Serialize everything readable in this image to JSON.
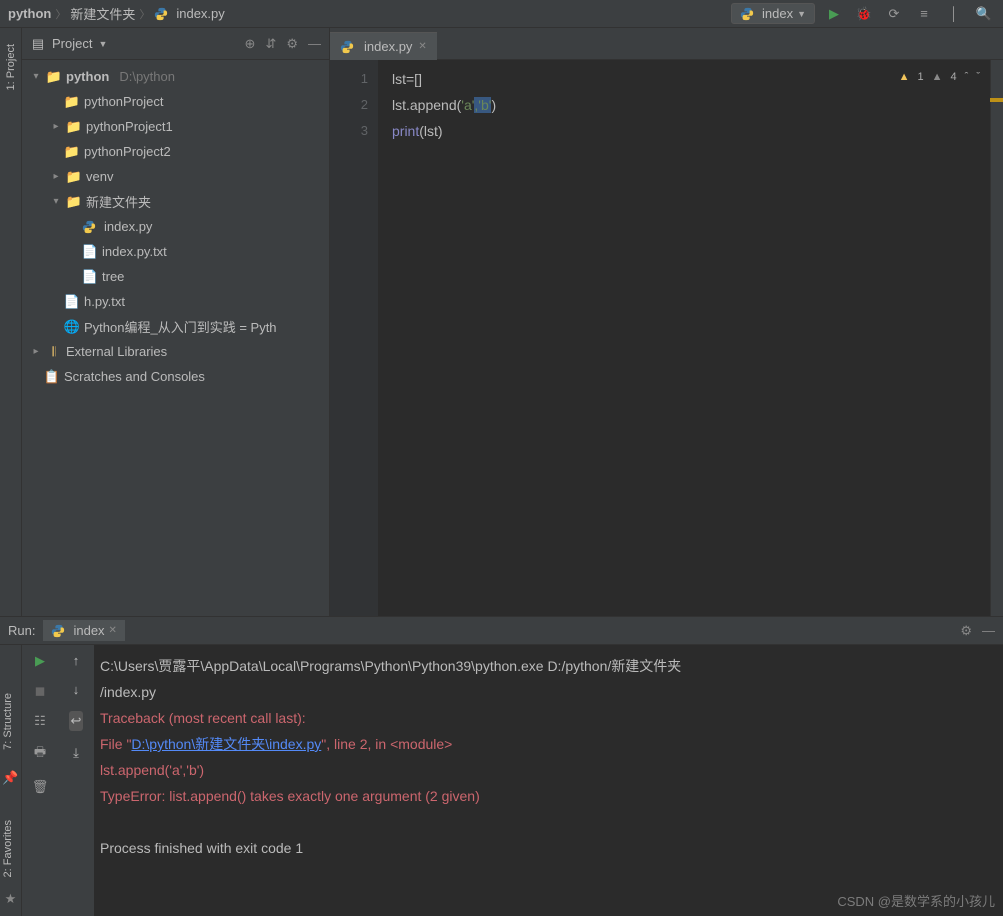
{
  "breadcrumbs": {
    "root": "python",
    "folder": "新建文件夹",
    "file": "index.py"
  },
  "runConfig": {
    "label": "index"
  },
  "leftGutter": {
    "project": "1: Project",
    "structure": "7: Structure",
    "favorites": "2: Favorites"
  },
  "projectPanel": {
    "title": "Project"
  },
  "tree": {
    "root": "python",
    "rootPath": "D:\\python",
    "nodes": {
      "pythonProject": "pythonProject",
      "pythonProject1": "pythonProject1",
      "pythonProject2": "pythonProject2",
      "venv": "venv",
      "newFolder": "新建文件夹",
      "indexpy": "index.py",
      "indexpytxt": "index.py.txt",
      "tree": "tree",
      "hpytxt": "h.py.txt",
      "pythonBook": "Python编程_从入门到实践 = Pyth",
      "externalLibs": "External Libraries",
      "scratches": "Scratches and Consoles"
    }
  },
  "editorTab": {
    "label": "index.py"
  },
  "code": {
    "lineNums": {
      "l1": "1",
      "l2": "2",
      "l3": "3"
    },
    "l1a": "lst=[]",
    "l2_a": "lst.append(",
    "l2_str1": "'a'",
    "l2_err": ",'b'",
    "l2_b": ")",
    "l3_fn": "print",
    "l3_p1": "(",
    "l3_arg": "lst",
    "l3_p2": ")"
  },
  "warnings": {
    "w1": "1",
    "w2": "4"
  },
  "runPanel": {
    "title": "Run:",
    "tab": "index",
    "line1": "C:\\Users\\贾露平\\AppData\\Local\\Programs\\Python\\Python39\\python.exe D:/python/新建文件夹",
    "line1b": "/index.py",
    "traceback": "Traceback (most recent call last):",
    "fileA": "  File \"",
    "fileLink": "D:\\python\\新建文件夹\\index.py",
    "fileB": "\", line 2, in <module>",
    "codeLine": "    lst.append('a','b')",
    "typeErr": "TypeError: list.append() takes exactly one argument (2 given)",
    "exit": "Process finished with exit code 1"
  },
  "watermark": "CSDN @是数学系的小孩儿"
}
